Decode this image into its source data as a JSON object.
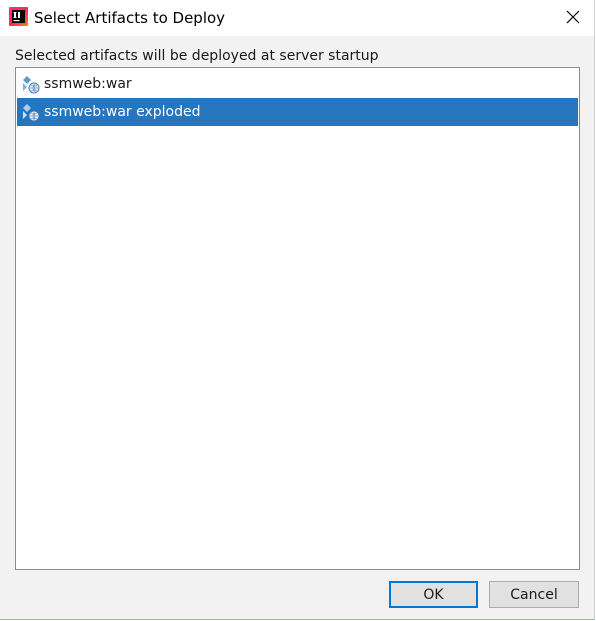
{
  "window": {
    "title": "Select Artifacts to Deploy"
  },
  "caption": "Selected artifacts will be deployed at server startup",
  "artifacts": [
    {
      "label": "ssmweb:war",
      "icon": "artifact-war-icon",
      "selected": false
    },
    {
      "label": "ssmweb:war exploded",
      "icon": "artifact-war-exploded-icon",
      "selected": true
    }
  ],
  "buttons": {
    "ok_label": "OK",
    "cancel_label": "Cancel"
  },
  "colors": {
    "selection": "#2675bf",
    "focus_border": "#0078d7"
  }
}
